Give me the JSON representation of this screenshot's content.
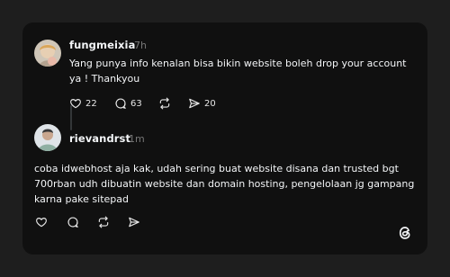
{
  "post": {
    "author": "fungmeixia",
    "time": "7h",
    "text": "Yang punya info kenalan bisa bikin website boleh drop your account ya ! Thankyou",
    "like_count": "22",
    "reply_count": "63",
    "share_count": "20"
  },
  "reply": {
    "author": "rievandrst",
    "time": "1m",
    "text": "coba idwebhost aja kak, udah sering buat website disana dan trusted bgt 700rban udh dibuatin website dan domain hosting, pengelolaan jg gampang karna pake sitepad"
  },
  "icons": {
    "like": "heart-icon",
    "reply": "comment-icon",
    "repost": "repost-icon",
    "share": "send-icon",
    "brand": "threads-logo-icon"
  }
}
